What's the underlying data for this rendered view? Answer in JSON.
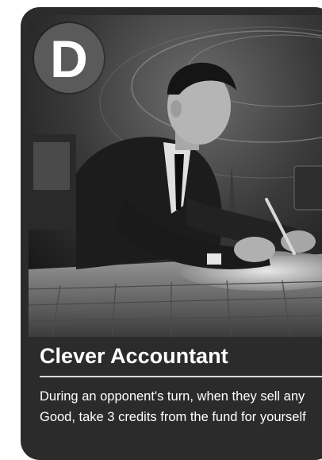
{
  "card": {
    "badge_letter": "D",
    "title": "Clever Accountant",
    "description": "During an opponent's turn, when they sell any Good, take 3 credits from the fund for yourself"
  },
  "colors": {
    "card_background": "#2b2b2b",
    "badge_background": "#5a5a5a",
    "text": "#ffffff",
    "divider": "#d8d8d8"
  }
}
